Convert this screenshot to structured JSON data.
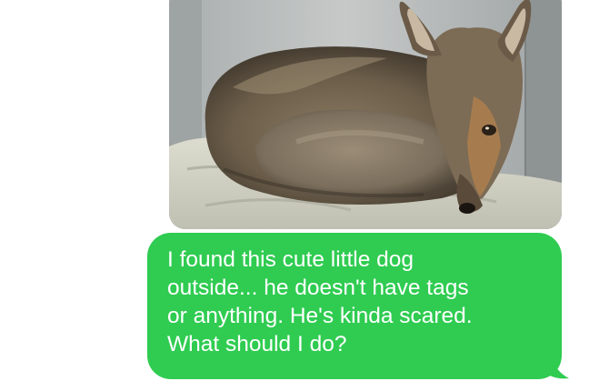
{
  "conversation": {
    "messages": [
      {
        "type": "image",
        "image_content": "coyote-photo"
      },
      {
        "type": "text",
        "text": "I found this cute little dog\noutside... he doesn't have tags\nor anything. He's kinda scared.\nWhat should I do?"
      }
    ],
    "colors": {
      "sent_bubble": "#2fcc51",
      "sent_text": "#ffffff",
      "background": "#ffffff"
    }
  }
}
